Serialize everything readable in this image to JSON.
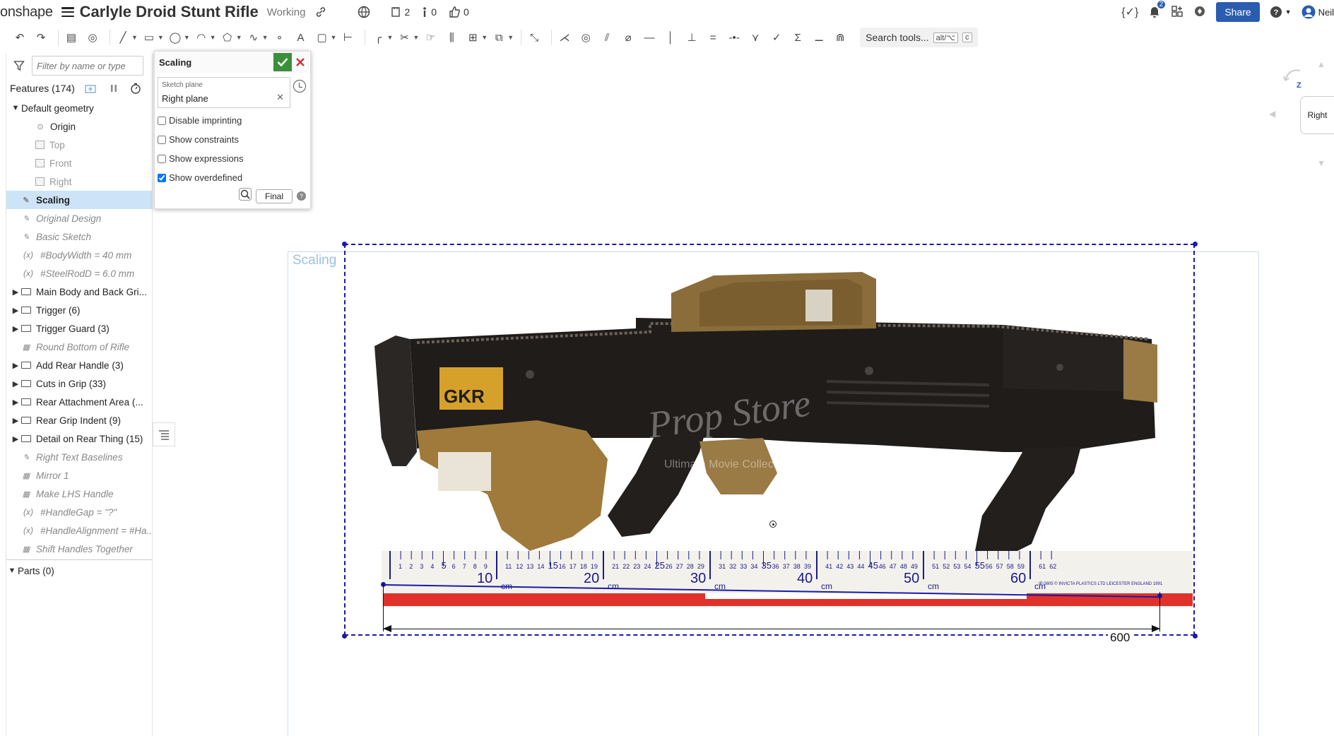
{
  "header": {
    "logo": "onshape",
    "doc_title": "Carlyle Droid Stunt Rifle",
    "doc_status": "Working",
    "versions_count": "2",
    "branches_count": "0",
    "likes_count": "0",
    "notif_badge": "2",
    "share_label": "Share",
    "user_label": "Neil"
  },
  "toolbar": {
    "search_placeholder": "Search tools...",
    "search_shortcut_1": "alt/⌥",
    "search_shortcut_2": "c"
  },
  "feature_panel": {
    "filter_placeholder": "Filter by name or type",
    "features_title": "Features (174)",
    "items": [
      {
        "label": "Default geometry",
        "kind": "group-open",
        "indent": 0
      },
      {
        "label": "Origin",
        "kind": "origin",
        "indent": 1
      },
      {
        "label": "Top",
        "kind": "plane",
        "indent": 1
      },
      {
        "label": "Front",
        "kind": "plane",
        "indent": 1
      },
      {
        "label": "Right",
        "kind": "plane",
        "indent": 1
      },
      {
        "label": "Scaling",
        "kind": "sketch-selected",
        "indent": 0
      },
      {
        "label": "Original Design",
        "kind": "sketch-italic",
        "indent": 0
      },
      {
        "label": "Basic Sketch",
        "kind": "sketch-italic",
        "indent": 0
      },
      {
        "label": "#BodyWidth = 40 mm",
        "kind": "var-italic",
        "indent": 0
      },
      {
        "label": "#SteelRodD = 6.0 mm",
        "kind": "var-italic",
        "indent": 0
      },
      {
        "label": "Main Body and Back Gri...",
        "kind": "folder",
        "indent": 0
      },
      {
        "label": "Trigger (6)",
        "kind": "folder",
        "indent": 0
      },
      {
        "label": "Trigger Guard (3)",
        "kind": "folder",
        "indent": 0
      },
      {
        "label": "Round Bottom of Rifle",
        "kind": "feature-italic",
        "indent": 0
      },
      {
        "label": "Add Rear Handle (3)",
        "kind": "folder",
        "indent": 0
      },
      {
        "label": "Cuts in Grip (33)",
        "kind": "folder",
        "indent": 0
      },
      {
        "label": "Rear Attachment Area (...",
        "kind": "folder",
        "indent": 0
      },
      {
        "label": "Rear Grip Indent (9)",
        "kind": "folder",
        "indent": 0
      },
      {
        "label": "Detail on Rear Thing (15)",
        "kind": "folder",
        "indent": 0
      },
      {
        "label": "Right Text Baselines",
        "kind": "sketch-italic",
        "indent": 0
      },
      {
        "label": "Mirror 1",
        "kind": "feature-italic",
        "indent": 0
      },
      {
        "label": "Make LHS Handle",
        "kind": "feature-italic",
        "indent": 0
      },
      {
        "label": "#HandleGap = \"?\"",
        "kind": "var-italic",
        "indent": 0
      },
      {
        "label": "#HandleAlignment = #Ha...",
        "kind": "var-italic",
        "indent": 0
      },
      {
        "label": "Shift Handles Together",
        "kind": "feature-italic",
        "indent": 0
      }
    ],
    "parts_label": "Parts (0)"
  },
  "dialog": {
    "title": "Scaling",
    "sketch_plane_label": "Sketch plane",
    "sketch_plane_value": "Right plane",
    "checks": [
      {
        "label": "Disable imprinting",
        "checked": false
      },
      {
        "label": "Show constraints",
        "checked": false
      },
      {
        "label": "Show expressions",
        "checked": false
      },
      {
        "label": "Show overdefined",
        "checked": true
      }
    ],
    "final_label": "Final"
  },
  "canvas": {
    "sketch_label": "Scaling",
    "dimension_value": "600",
    "ruler_cm_labels": [
      "10",
      "20",
      "30",
      "40",
      "50",
      "60"
    ],
    "ruler_unit": "cm",
    "ruler_imprint": "IP 0805 © INVICTA PLASTICS LTD LEICESTER ENGLAND 1991",
    "watermark": "Prop Store",
    "watermark_sub": "Ultimate Movie Collectables",
    "rifle_text": "GKR"
  },
  "view_cube": {
    "face": "Right",
    "axis": "Z"
  },
  "colors": {
    "accent": "#2a5db0",
    "sketch_blue": "#1a1aaa",
    "selection": "#cde3f7",
    "ok_green": "#3b8f3b"
  }
}
